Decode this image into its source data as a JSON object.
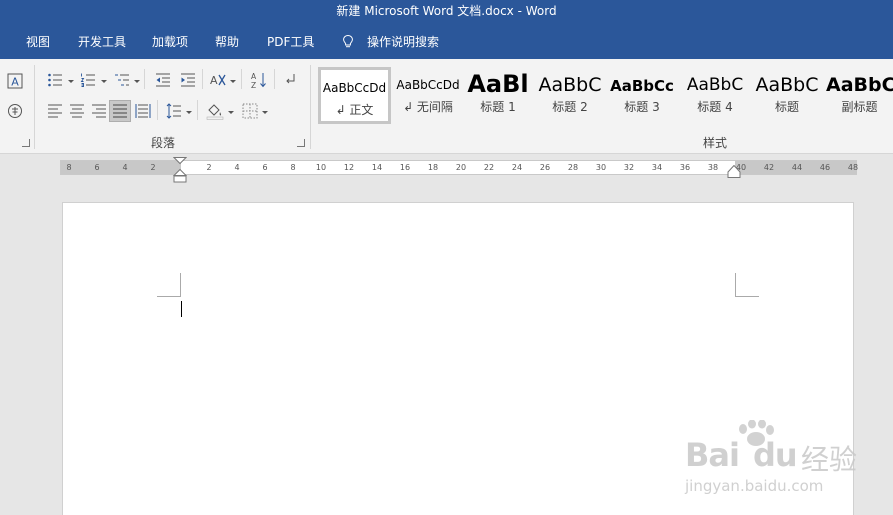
{
  "window": {
    "title": "新建 Microsoft Word 文档.docx  -  Word"
  },
  "menu": {
    "items": [
      "视图",
      "开发工具",
      "加载项",
      "帮助",
      "PDF工具"
    ],
    "tell_me": "操作说明搜索"
  },
  "ribbon": {
    "paragraph_group_label": "段落",
    "styles_group_label": "样式",
    "styles": [
      {
        "sample": "AaBbCcDd",
        "name": "↲ 正文"
      },
      {
        "sample": "AaBbCcDd",
        "name": "↲ 无间隔"
      },
      {
        "sample": "AaBl",
        "name": "标题 1"
      },
      {
        "sample": "AaBbC",
        "name": "标题 2"
      },
      {
        "sample": "AaBbCc",
        "name": "标题 3"
      },
      {
        "sample": "AaBbC",
        "name": "标题 4"
      },
      {
        "sample": "AaBbC",
        "name": "标题"
      },
      {
        "sample": "AaBbC",
        "name": "副标题"
      }
    ]
  },
  "ruler": {
    "ticks": [
      "8",
      "6",
      "4",
      "2",
      "",
      "2",
      "4",
      "6",
      "8",
      "10",
      "12",
      "14",
      "16",
      "18",
      "20",
      "22",
      "24",
      "26",
      "28",
      "30",
      "32",
      "34",
      "36",
      "38",
      "40",
      "42",
      "44",
      "46",
      "48"
    ]
  },
  "watermark": {
    "brand": "Bai",
    "brand2": "du",
    "cn": "经验",
    "url": "jingyan.baidu.com"
  },
  "colors": {
    "accent": "#2b579a",
    "ribbon": "#f3f3f3",
    "canvas": "#e6e6e6"
  }
}
